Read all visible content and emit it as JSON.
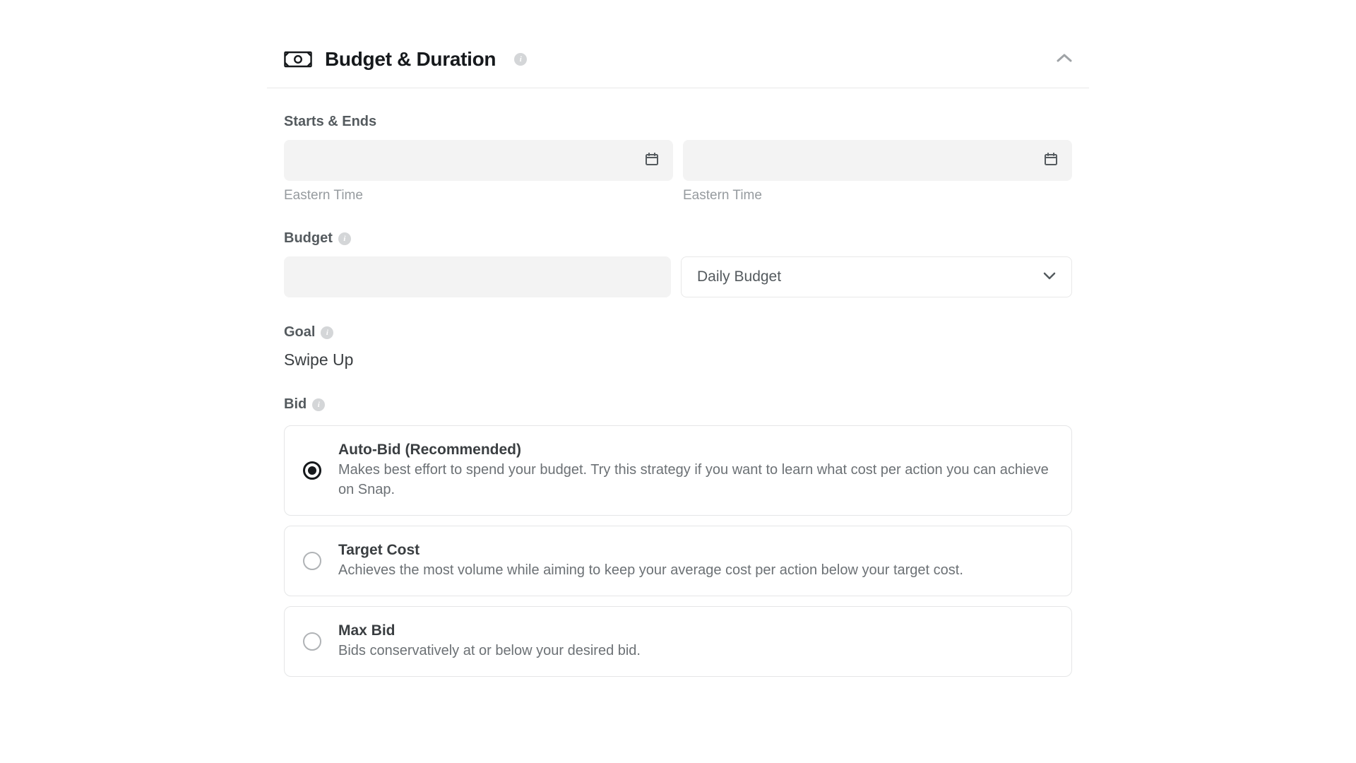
{
  "header": {
    "title": "Budget & Duration"
  },
  "dates": {
    "label": "Starts & Ends",
    "start_tz": "Eastern Time",
    "end_tz": "Eastern Time"
  },
  "budget": {
    "label": "Budget",
    "type_selected": "Daily Budget"
  },
  "goal": {
    "label": "Goal",
    "value": "Swipe Up"
  },
  "bid": {
    "label": "Bid",
    "options": [
      {
        "title": "Auto-Bid (Recommended)",
        "desc": "Makes best effort to spend your budget. Try this strategy if you want to learn what cost per action you can achieve on Snap.",
        "selected": true
      },
      {
        "title": "Target Cost",
        "desc": "Achieves the most volume while aiming to keep your average cost per action below your target cost.",
        "selected": false
      },
      {
        "title": "Max Bid",
        "desc": "Bids conservatively at or below your desired bid.",
        "selected": false
      }
    ]
  }
}
